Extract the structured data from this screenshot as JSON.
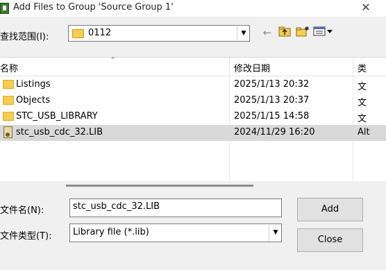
{
  "window": {
    "title": "Add Files to Group 'Source Group 1'",
    "close_glyph": "✕"
  },
  "look_in": {
    "label": "查找范围(I):",
    "value": "0112"
  },
  "toolbar": {
    "back_glyph": "←",
    "up_glyph": "⬑",
    "new_folder_glyph": "✱",
    "view_glyph": "▦▾"
  },
  "columns": {
    "name": "名称",
    "date": "修改日期",
    "type": "类"
  },
  "files": [
    {
      "name": "Listings",
      "date": "2025/1/13 20:32",
      "type": "文",
      "icon": "folder-icon"
    },
    {
      "name": "Objects",
      "date": "2025/1/13 20:37",
      "type": "文",
      "icon": "folder-icon"
    },
    {
      "name": "STC_USB_LIBRARY",
      "date": "2025/1/15 14:58",
      "type": "文",
      "icon": "folder-icon"
    },
    {
      "name": "stc_usb_cdc_32.LIB",
      "date": "2024/11/29 16:20",
      "type": "Alt",
      "icon": "lib-file-icon",
      "selected": true
    }
  ],
  "file_name": {
    "label": "文件名(N):",
    "value": "stc_usb_cdc_32.LIB"
  },
  "file_type": {
    "label": "文件类型(T):",
    "value": "Library file (*.lib)"
  },
  "buttons": {
    "add": "Add",
    "close": "Close"
  },
  "colors": {
    "selection": "#d9d9d9",
    "folder": "#f7cd52",
    "window_bg": "#f0f0f0"
  }
}
